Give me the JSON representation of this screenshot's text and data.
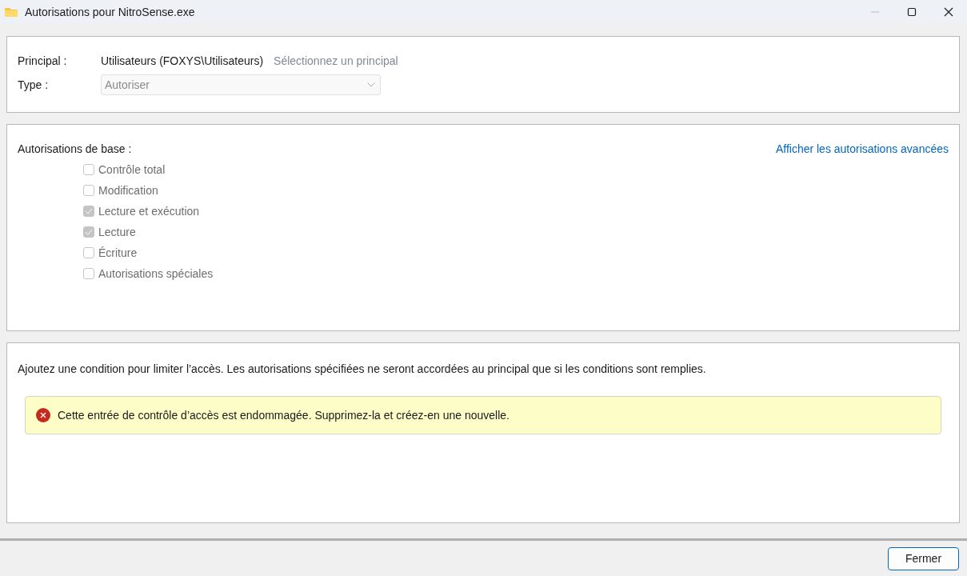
{
  "window": {
    "title": "Autorisations pour NitroSense.exe",
    "controls": [
      {
        "kind": "minimize",
        "disabled": true
      },
      {
        "kind": "maximize",
        "disabled": false
      },
      {
        "kind": "close",
        "disabled": false
      }
    ]
  },
  "principal": {
    "label": "Principal :",
    "value": "Utilisateurs (FOXYS\\Utilisateurs)",
    "link": "Sélectionnez un principal"
  },
  "type": {
    "label": "Type :",
    "value": "Autoriser",
    "disabled": true
  },
  "permissions": {
    "title": "Autorisations de base :",
    "advanced_link": "Afficher les autorisations avancées",
    "items": [
      {
        "label": "Contrôle total",
        "checked": false,
        "disabled": true
      },
      {
        "label": "Modification",
        "checked": false,
        "disabled": true
      },
      {
        "label": "Lecture et exécution",
        "checked": true,
        "disabled": true
      },
      {
        "label": "Lecture",
        "checked": true,
        "disabled": true
      },
      {
        "label": "Écriture",
        "checked": false,
        "disabled": true
      },
      {
        "label": "Autorisations spéciales",
        "checked": false,
        "disabled": true
      }
    ]
  },
  "condition": {
    "text": "Ajoutez une condition pour limiter l’accès. Les autorisations spécifiées ne seront accordées au principal que si les conditions sont remplies.",
    "error": "Cette entrée de contrôle d’accès est endommagée. Supprimez-la et créez-en une nouvelle."
  },
  "buttons": [
    "Fermer"
  ]
}
